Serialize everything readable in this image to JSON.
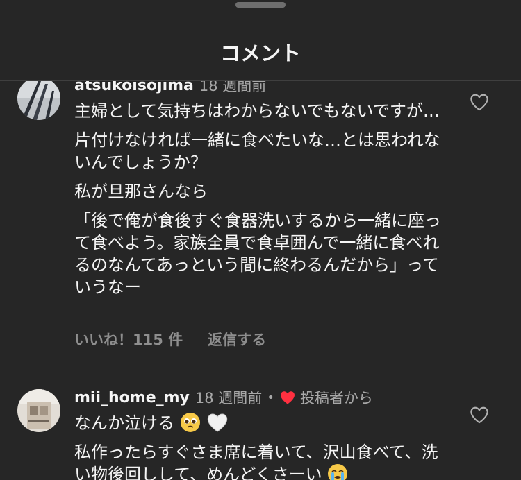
{
  "sheet": {
    "title": "コメント"
  },
  "comments": [
    {
      "username": "atsukoisojima",
      "time": "18 週間前",
      "paragraphs": [
        "主婦として気持ちはわからないでもないですが…",
        "片付けなければ一緒に食べたいな…とは思われないんでしょうか？",
        "私が旦那さんなら",
        "「後で俺が食後すぐ食器洗いするから一緒に座って食べよう。家族全員で食卓囲んで一緒に食べれるのなんてあっという間に終わるんだから」っていうなー"
      ],
      "likes_label": "いいね！115 件",
      "reply_label": "返信する"
    },
    {
      "username": "mii_home_my",
      "time": "18 週間前",
      "separator": "•",
      "author_badge": "投稿者から",
      "text_line1": "なんか泣ける",
      "paragraph2": "私作ったらすぐさま席に着いて、沢山食べて、洗い物後回しして、めんどくさーい"
    }
  ],
  "colors": {
    "background": "#262626",
    "text": "#f5f5f5",
    "secondary": "#a8a8a8",
    "action": "#8e8e8e",
    "author_heart": "#ff3040"
  },
  "icons": [
    "heart-outline-icon",
    "heart-filled-icon",
    "pleading-face-emoji",
    "white-heart-emoji",
    "crying-face-emoji"
  ]
}
